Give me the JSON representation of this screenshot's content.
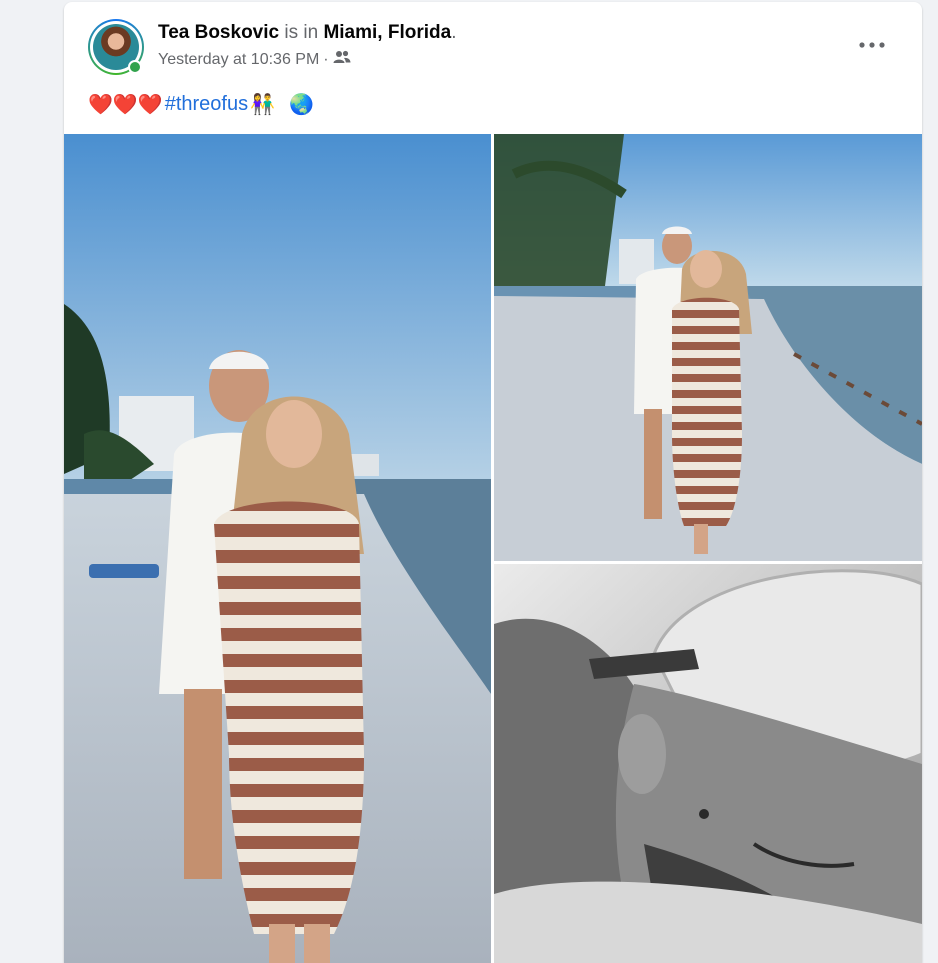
{
  "post": {
    "author": "Tea Boskovic",
    "is_in": "is in",
    "location": "Miami, Florida",
    "period": ".",
    "timestamp": "Yesterday at 10:36 PM",
    "separator": "·",
    "audience_icon": "friends-icon",
    "text": {
      "hearts": "❤️❤️❤️",
      "hashtag": "#threofus",
      "emoji_family": "👫",
      "emoji_globe": "🌏"
    },
    "more_icon": "more-horizontal-icon"
  },
  "photos": [
    {
      "description_icon": "photo-couple-beach-portrait"
    },
    {
      "description_icon": "photo-couple-beach-walk"
    },
    {
      "description_icon": "photo-bw-kiss-closeup"
    }
  ],
  "colors": {
    "link": "#216fdb",
    "secondary_text": "#65676b",
    "online": "#31a24c"
  }
}
